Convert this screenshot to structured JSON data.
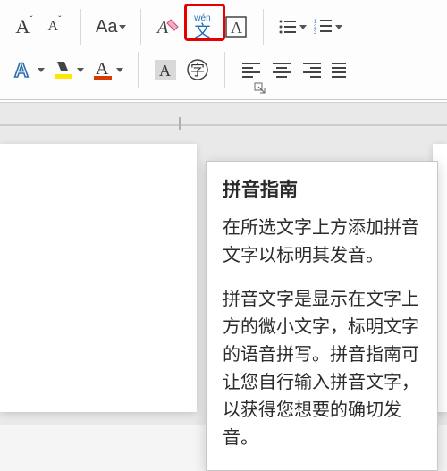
{
  "ribbon": {
    "grow_font": "A",
    "shrink_font": "A",
    "change_case": "Aa",
    "clear_format": "A",
    "phonetic_guide_top": "wén",
    "phonetic_guide_bottom": "文",
    "char_border": "A",
    "text_effects": "A",
    "highlight": "",
    "font_color": "A",
    "char_shading": "A",
    "enclose_char": "字"
  },
  "tooltip": {
    "title": "拼音指南",
    "p1": "在所选文字上方添加拼音文字以标明其发音。",
    "p2": "拼音文字是显示在文字上方的微小文字，标明文字的语音拼写。拼音指南可让您自行输入拼音文字，以获得您想要的确切发音。"
  }
}
